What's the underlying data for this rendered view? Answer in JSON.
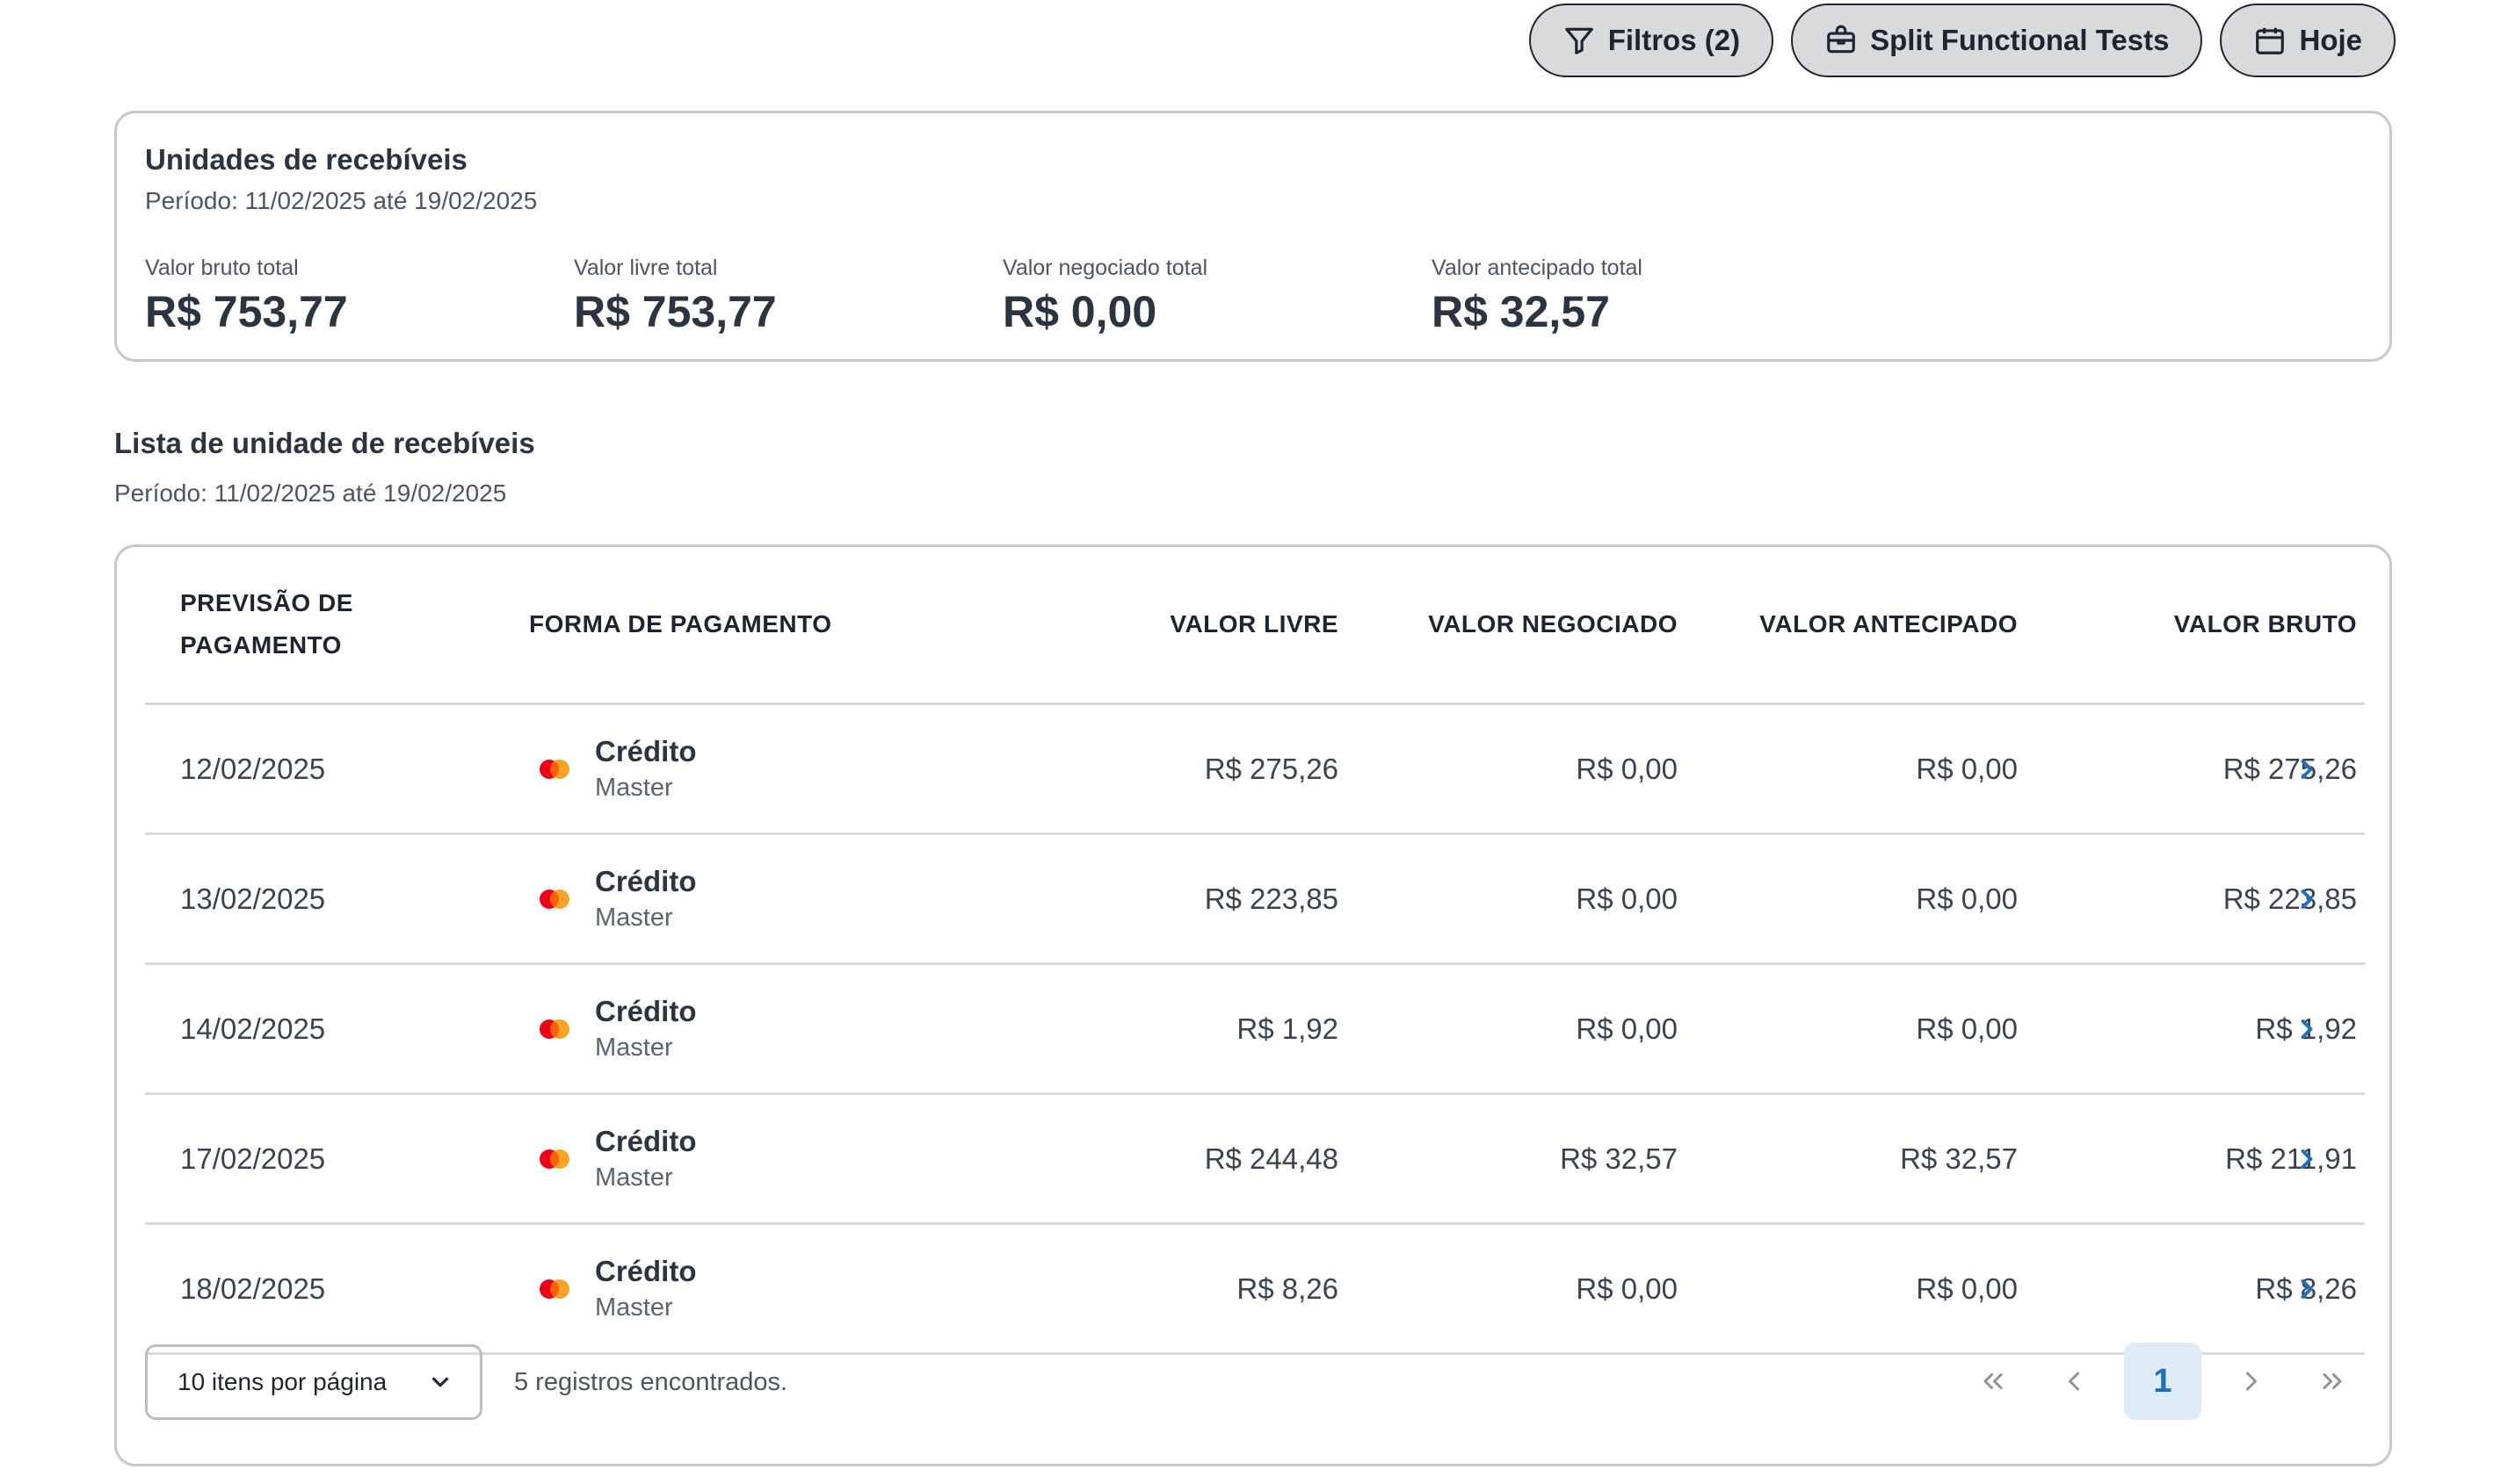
{
  "toolbar": {
    "filters_label": "Filtros (2)",
    "merchant_label": "Split Functional Tests",
    "date_label": "Hoje"
  },
  "summary": {
    "title": "Unidades de recebíveis",
    "period": "Período: 11/02/2025 até 19/02/2025",
    "metrics": [
      {
        "label": "Valor bruto total",
        "value": "R$ 753,77"
      },
      {
        "label": "Valor livre total",
        "value": "R$ 753,77"
      },
      {
        "label": "Valor negociado total",
        "value": "R$ 0,00"
      },
      {
        "label": "Valor antecipado total",
        "value": "R$ 32,57"
      }
    ]
  },
  "list": {
    "title": "Lista de unidade de recebíveis",
    "period": "Período: 11/02/2025 até 19/02/2025"
  },
  "table": {
    "headers": {
      "date_line1": "PREVISÃO DE",
      "date_line2": "PAGAMENTO",
      "payment": "FORMA DE PAGAMENTO",
      "free": "VALOR LIVRE",
      "negotiated": "VALOR NEGOCIADO",
      "anticipated": "VALOR ANTECIPADO",
      "gross": "VALOR BRUTO"
    },
    "rows": [
      {
        "date": "12/02/2025",
        "type": "Crédito",
        "brand": "Master",
        "free": "R$ 275,26",
        "negotiated": "R$ 0,00",
        "anticipated": "R$ 0,00",
        "gross": "R$ 275,26"
      },
      {
        "date": "13/02/2025",
        "type": "Crédito",
        "brand": "Master",
        "free": "R$ 223,85",
        "negotiated": "R$ 0,00",
        "anticipated": "R$ 0,00",
        "gross": "R$ 223,85"
      },
      {
        "date": "14/02/2025",
        "type": "Crédito",
        "brand": "Master",
        "free": "R$ 1,92",
        "negotiated": "R$ 0,00",
        "anticipated": "R$ 0,00",
        "gross": "R$ 1,92"
      },
      {
        "date": "17/02/2025",
        "type": "Crédito",
        "brand": "Master",
        "free": "R$ 244,48",
        "negotiated": "R$ 32,57",
        "anticipated": "R$ 32,57",
        "gross": "R$ 211,91"
      },
      {
        "date": "18/02/2025",
        "type": "Crédito",
        "brand": "Master",
        "free": "R$ 8,26",
        "negotiated": "R$ 0,00",
        "anticipated": "R$ 0,00",
        "gross": "R$ 8,26"
      }
    ]
  },
  "footer": {
    "per_page": "10 itens por página",
    "records": "5 registros encontrados.",
    "current_page": "1"
  },
  "icons": {
    "filter": "filter-icon",
    "merchant": "store-icon",
    "date": "calendar-icon",
    "card_brand": "mastercard-icon",
    "row_action": "chevron-right-icon",
    "dropdown": "chevron-down-icon",
    "first": "chevrons-left-icon",
    "prev": "chevron-left-icon",
    "next": "chevron-right-icon",
    "last": "chevrons-right-icon"
  },
  "colors": {
    "accent": "#1f6fbf",
    "pill_bg": "#d9dadc",
    "mastercard_red": "#eb001b",
    "mastercard_orange": "#f79e1b"
  }
}
